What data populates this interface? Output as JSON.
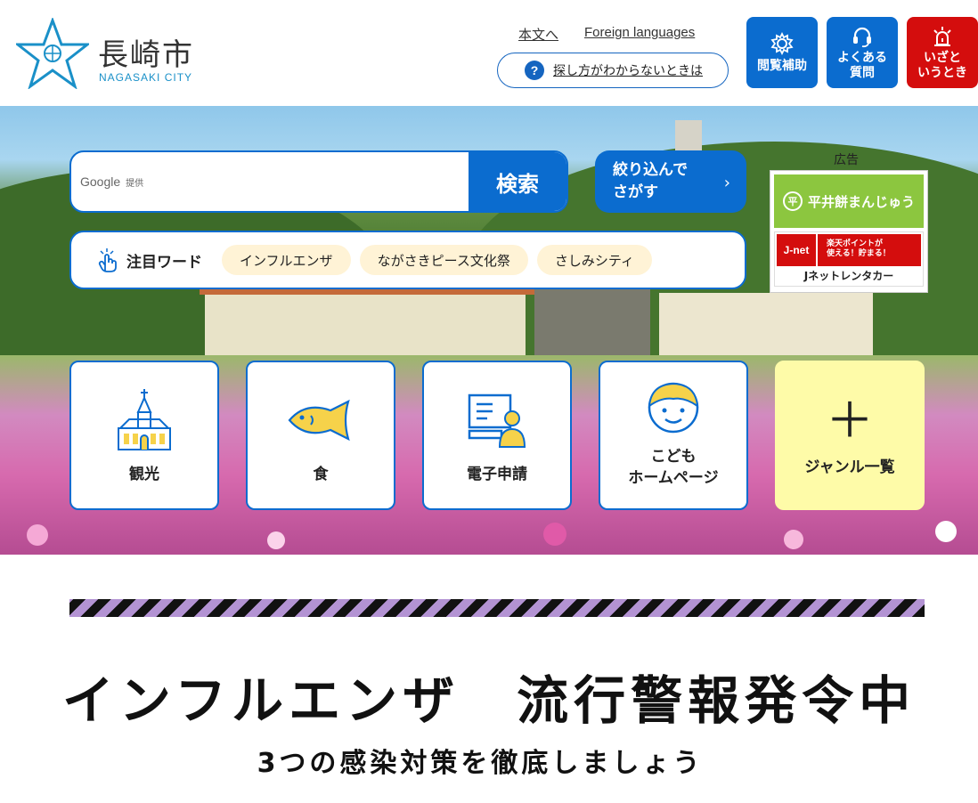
{
  "header": {
    "logo_name": "長崎市",
    "logo_sub": "NAGASAKI CITY",
    "links": {
      "main_content": "本文へ",
      "foreign_languages": "Foreign languages"
    },
    "howto": {
      "icon": "?",
      "label": "探し方がわからないときは"
    },
    "buttons": {
      "accessibility": "閲覧補助",
      "faq_line1": "よくある",
      "faq_line2": "質問",
      "emergency_line1": "いざと",
      "emergency_line2": "いうとき"
    },
    "colors": {
      "primary": "#0b6ccf",
      "emergency": "#d40d0d"
    }
  },
  "search": {
    "provider": "Google",
    "provider_sub": "提供",
    "button": "検索",
    "narrow_line1": "絞り込んで",
    "narrow_line2": "さがす",
    "narrow_chevron": "›"
  },
  "keywords": {
    "title": "注目ワード",
    "items": [
      "インフルエンザ",
      "ながさきピース文化祭",
      "さしみシティ"
    ]
  },
  "ad": {
    "label": "広告",
    "ad1_text": "平井餅まんじゅう",
    "ad2_jnet": "J-net",
    "ad2_rakuten_line1": "楽天ポイントが",
    "ad2_rakuten_line2": "使える！貯まる！",
    "ad2_rental": "Jネットレンタカー"
  },
  "tiles": {
    "tourism": "観光",
    "food": "食",
    "e_application": "電子申請",
    "kids_line1": "こども",
    "kids_line2": "ホームページ",
    "genre_list": "ジャンル一覧",
    "genre_plus": "＋"
  },
  "alert": {
    "title": "インフルエンザ　流行警報発令中",
    "subtitle": "3つの感染対策を徹底しましょう"
  }
}
